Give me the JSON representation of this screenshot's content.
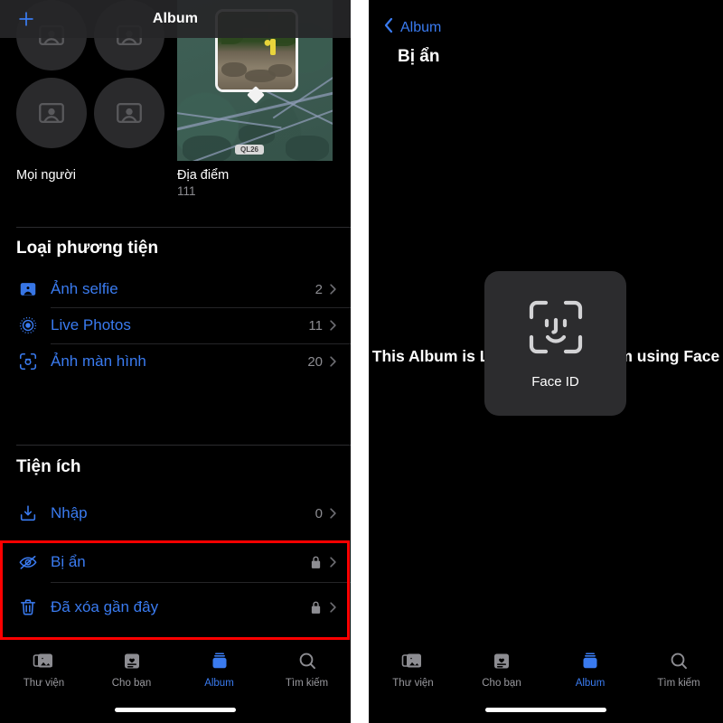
{
  "colors": {
    "accent_blue": "#3a7bf0",
    "highlight_red": "#fe0000",
    "background": "#000000",
    "secondary_text": "#8d8d92",
    "faceid_panel": "#2c2c2e"
  },
  "left_screen": {
    "navbar": {
      "add_icon": "plus-icon",
      "title": "Album"
    },
    "top_cells": [
      {
        "label": "Mọi người",
        "count": "",
        "icon": "people-placeholder-icon"
      },
      {
        "label": "Địa điểm",
        "count": "111",
        "icon": "map-thumbnail"
      }
    ],
    "map_chip_label": "QL26",
    "sections": [
      {
        "title": "Loại phương tiện",
        "rows": [
          {
            "icon": "selfie-icon",
            "label": "Ảnh selfie",
            "count": "2",
            "locked": false
          },
          {
            "icon": "live-photos-icon",
            "label": "Live Photos",
            "count": "11",
            "locked": false
          },
          {
            "icon": "screenshot-icon",
            "label": "Ảnh màn hình",
            "count": "20",
            "locked": false
          }
        ]
      },
      {
        "title": "Tiện ích",
        "rows": [
          {
            "icon": "import-icon",
            "label": "Nhập",
            "count": "0",
            "locked": false
          },
          {
            "icon": "eye-slash-icon",
            "label": "Bị ẩn",
            "count": "",
            "locked": true
          },
          {
            "icon": "trash-icon",
            "label": "Đã xóa gần đây",
            "count": "",
            "locked": true
          }
        ]
      }
    ],
    "tabs": [
      {
        "label": "Thư viện",
        "icon": "library-icon",
        "active": false
      },
      {
        "label": "Cho bạn",
        "icon": "for-you-icon",
        "active": false
      },
      {
        "label": "Album",
        "icon": "albums-icon",
        "active": true
      },
      {
        "label": "Tìm kiếm",
        "icon": "search-icon",
        "active": false
      }
    ]
  },
  "right_screen": {
    "back_label": "Album",
    "back_icon": "chevron-left-icon",
    "title": "Bị ẩn",
    "locked_message": "This Album is Locked. View Album using Face ID.",
    "faceid": {
      "icon": "face-id-icon",
      "label": "Face ID"
    },
    "tabs": [
      {
        "label": "Thư viện",
        "icon": "library-icon",
        "active": false
      },
      {
        "label": "Cho bạn",
        "icon": "for-you-icon",
        "active": false
      },
      {
        "label": "Album",
        "icon": "albums-icon",
        "active": true
      },
      {
        "label": "Tìm kiếm",
        "icon": "search-icon",
        "active": false
      }
    ]
  }
}
